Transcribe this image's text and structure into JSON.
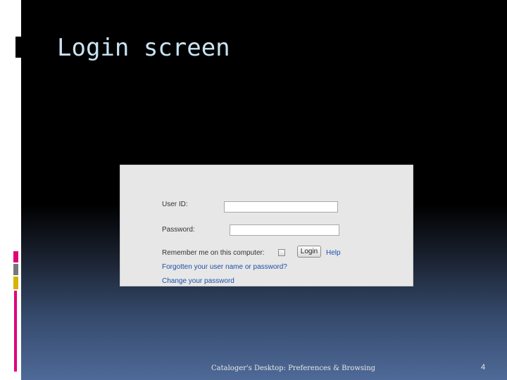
{
  "slide": {
    "title": "Login screen",
    "footer": "Cataloger's Desktop: Preferences & Browsing",
    "page_number": "4"
  },
  "login": {
    "user_id_label": "User ID:",
    "user_id_value": "",
    "password_label": "Password:",
    "password_value": "",
    "remember_label": "Remember me on this computer:",
    "remember_checked": false,
    "login_button": "Login",
    "help_link": "Help",
    "forgot_link": "Forgotten your user name or password?",
    "change_password_link": "Change your password"
  },
  "colors": {
    "link": "#1f4fa8",
    "title": "#c9e4f2",
    "accent_magenta": "#e0007a",
    "accent_yellow": "#d4b400"
  }
}
